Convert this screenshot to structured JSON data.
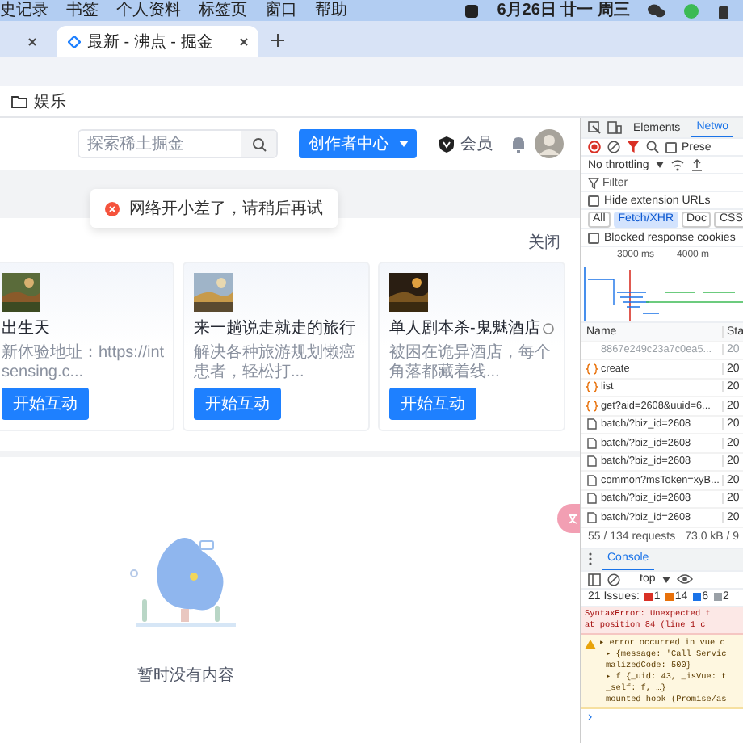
{
  "menubar": {
    "items": [
      "史记录",
      "书签",
      "个人资料",
      "标签页",
      "窗口",
      "帮助"
    ],
    "clock": "6月26日 廿一 周三"
  },
  "browser": {
    "tabs": [
      {
        "selected": false
      },
      {
        "title": "最新 - 沸点 - 掘金",
        "selected": true
      }
    ],
    "bookmarks": [
      "娱乐"
    ]
  },
  "page": {
    "search": {
      "placeholder": "探索稀土掘金"
    },
    "creator_button": "创作者中心",
    "vip": "会员",
    "toast": "网络开小差了，请稍后再试",
    "close": "关闭",
    "cards": [
      {
        "title": "出生天",
        "description": "新体验地址：https://intsensing.c...",
        "button": "开始互动",
        "badge": false
      },
      {
        "title": "来一趟说走就走的旅行",
        "description": "解决各种旅游规划懒癌患者，轻松打...",
        "button": "开始互动",
        "badge": false
      },
      {
        "title": "单人剧本杀-鬼魅酒店",
        "description": "被困在诡异酒店，每个角落都藏着线...",
        "button": "开始互动",
        "badge": true
      }
    ],
    "empty_text": "暂时没有内容"
  },
  "devtools": {
    "tabs": [
      {
        "label": "Elements",
        "selected": false
      },
      {
        "label": "Netwo",
        "selected": true
      }
    ],
    "preserve": {
      "label": "Prese",
      "checked": false
    },
    "throttling": "No throttling",
    "filter_placeholder": "Filter",
    "hide_ext": {
      "label": "Hide extension URLs",
      "checked": false
    },
    "types": [
      {
        "label": "All",
        "selected": false
      },
      {
        "label": "Fetch/XHR",
        "selected": true
      },
      {
        "label": "Doc",
        "selected": false
      },
      {
        "label": "CSS",
        "selected": false
      }
    ],
    "blocked": {
      "label": "Blocked response cookies",
      "checked": false
    },
    "timeline_ticks": [
      "3000 ms",
      "4000 m"
    ],
    "columns": [
      "Name",
      "Sta"
    ],
    "requests": [
      {
        "name": "8867e249c23a7c0ea5...",
        "status": "20",
        "kind": "plain",
        "dimmed": true
      },
      {
        "name": "create",
        "status": "20",
        "kind": "fetch",
        "dimmed": false
      },
      {
        "name": "list",
        "status": "20",
        "kind": "fetch",
        "dimmed": false
      },
      {
        "name": "get?aid=2608&uuid=6...",
        "status": "20",
        "kind": "fetch",
        "dimmed": false
      },
      {
        "name": "batch/?biz_id=2608",
        "status": "20",
        "kind": "doc",
        "dimmed": false
      },
      {
        "name": "batch/?biz_id=2608",
        "status": "20",
        "kind": "doc",
        "dimmed": false
      },
      {
        "name": "batch/?biz_id=2608",
        "status": "20",
        "kind": "doc",
        "dimmed": false
      },
      {
        "name": "common?msToken=xyB...",
        "status": "20",
        "kind": "doc",
        "dimmed": false
      },
      {
        "name": "batch/?biz_id=2608",
        "status": "20",
        "kind": "doc",
        "dimmed": false
      },
      {
        "name": "batch/?biz_id=2608",
        "status": "20",
        "kind": "doc",
        "dimmed": false
      }
    ],
    "summary": [
      "55 / 134 requests",
      "73.0 kB / 9"
    ]
  },
  "console": {
    "tab": "Console",
    "context": "top",
    "issues_label": "21 Issues:",
    "issues": [
      {
        "count": "1",
        "color": "#d93025"
      },
      {
        "count": "14",
        "color": "#e8710a"
      },
      {
        "count": "6",
        "color": "#1a73e8"
      },
      {
        "count": "2",
        "color": "#9aa0a6"
      }
    ],
    "messages": [
      {
        "kind": "error",
        "lines": [
          "SyntaxError: Unexpected t",
          "at position 84 (line 1 c"
        ]
      },
      {
        "kind": "warning",
        "lines": [
          "▸ error occurred in vue c",
          "▸ {message: 'Call Servic",
          "malizedCode: 500}",
          "▸ f {_uid: 43, _isVue: t",
          "_self: f, …}",
          "mounted hook (Promise/as"
        ]
      }
    ],
    "prompt": "›"
  }
}
